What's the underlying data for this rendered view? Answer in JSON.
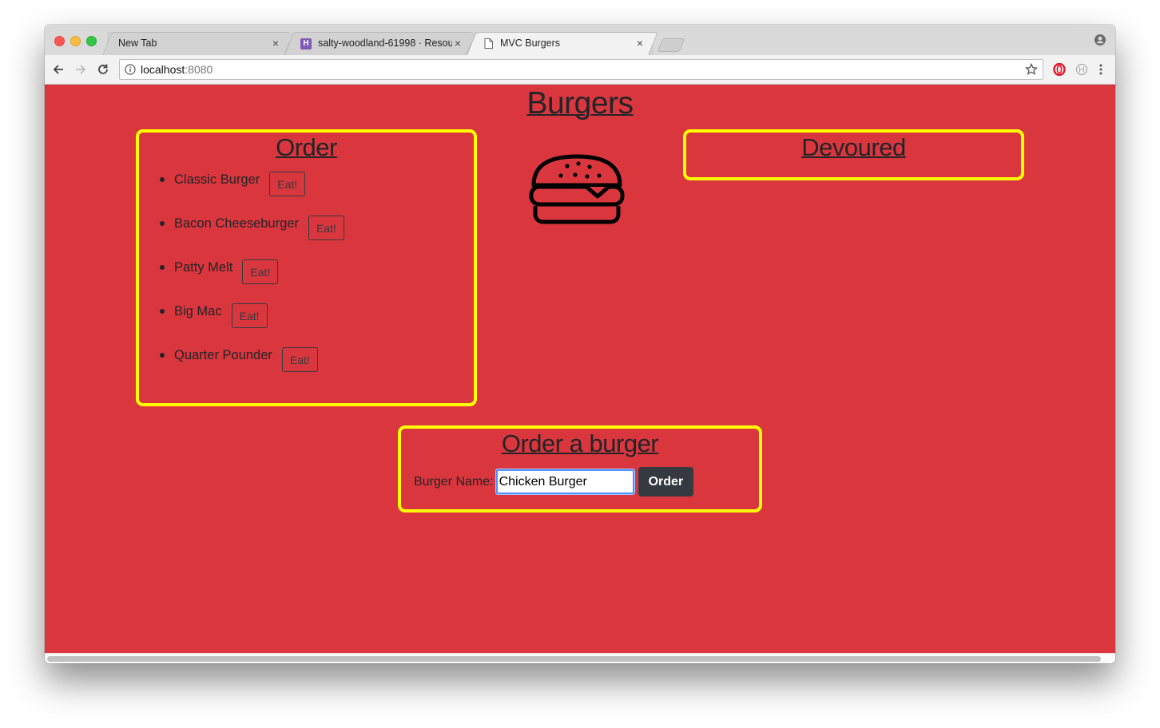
{
  "browser": {
    "tabs": [
      {
        "title": "New Tab",
        "favicon": "none",
        "active": false
      },
      {
        "title": "salty-woodland-61998 · Resou",
        "favicon": "heroku-icon",
        "active": false
      },
      {
        "title": "MVC Burgers",
        "favicon": "page-icon",
        "active": true
      }
    ],
    "close_glyph": "×",
    "url_host": "localhost",
    "url_port": ":8080"
  },
  "page": {
    "title": "Burgers",
    "order_section": {
      "heading": "Order",
      "items": [
        {
          "name": "Classic Burger",
          "button": "Eat!"
        },
        {
          "name": "Bacon Cheeseburger",
          "button": "Eat!"
        },
        {
          "name": "Patty Melt",
          "button": "Eat!"
        },
        {
          "name": "Big Mac",
          "button": "Eat!"
        },
        {
          "name": "Quarter Pounder",
          "button": "Eat!"
        }
      ]
    },
    "devoured_section": {
      "heading": "Devoured"
    },
    "burger_image": "burger-icon",
    "form": {
      "heading": "Order a burger",
      "label": "Burger Name:",
      "input_value": "Chicken Burger",
      "submit_label": "Order"
    }
  },
  "colors": {
    "page_background": "#da363d",
    "box_border": "#ffff00",
    "button_dark": "#343a40"
  }
}
